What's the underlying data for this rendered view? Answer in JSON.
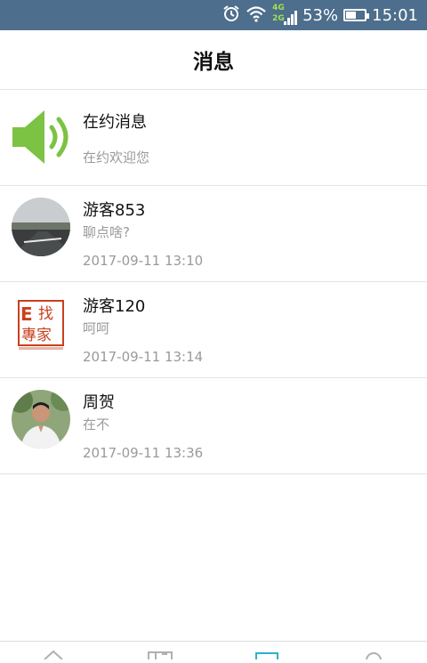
{
  "status_bar": {
    "network_4g": "4G",
    "network_2g": "2G",
    "battery": "53%",
    "battery_level": 0.53,
    "time": "15:01",
    "icons": [
      "alarm-icon",
      "wifi-icon",
      "signal-icon",
      "battery-icon"
    ]
  },
  "header": {
    "title": "消息"
  },
  "messages": [
    {
      "name": "在约消息",
      "preview": "在约欢迎您",
      "time": "",
      "avatar": "speaker-icon"
    },
    {
      "name": "游客853",
      "preview": "聊点啥?",
      "time": "2017-09-11 13:10",
      "avatar": "road-photo"
    },
    {
      "name": "游客120",
      "preview": "呵呵",
      "time": "2017-09-11 13:14",
      "avatar": "e-expert-logo"
    },
    {
      "name": "周贺",
      "preview": "在不",
      "time": "2017-09-11 13:36",
      "avatar": "person-photo"
    }
  ],
  "logo": {
    "line1": "E",
    "line2": "找",
    "line3": "專家"
  },
  "tabbar": {
    "icons": [
      "home-icon",
      "card-icon",
      "message-icon",
      "profile-icon"
    ],
    "active_index": 2,
    "active_color": "#2bb3c8",
    "inactive_color": "#b0b0b0"
  },
  "colors": {
    "status_bar": "#4d6e8c",
    "speaker_green": "#7cc243",
    "logo_red": "#c8401e"
  }
}
